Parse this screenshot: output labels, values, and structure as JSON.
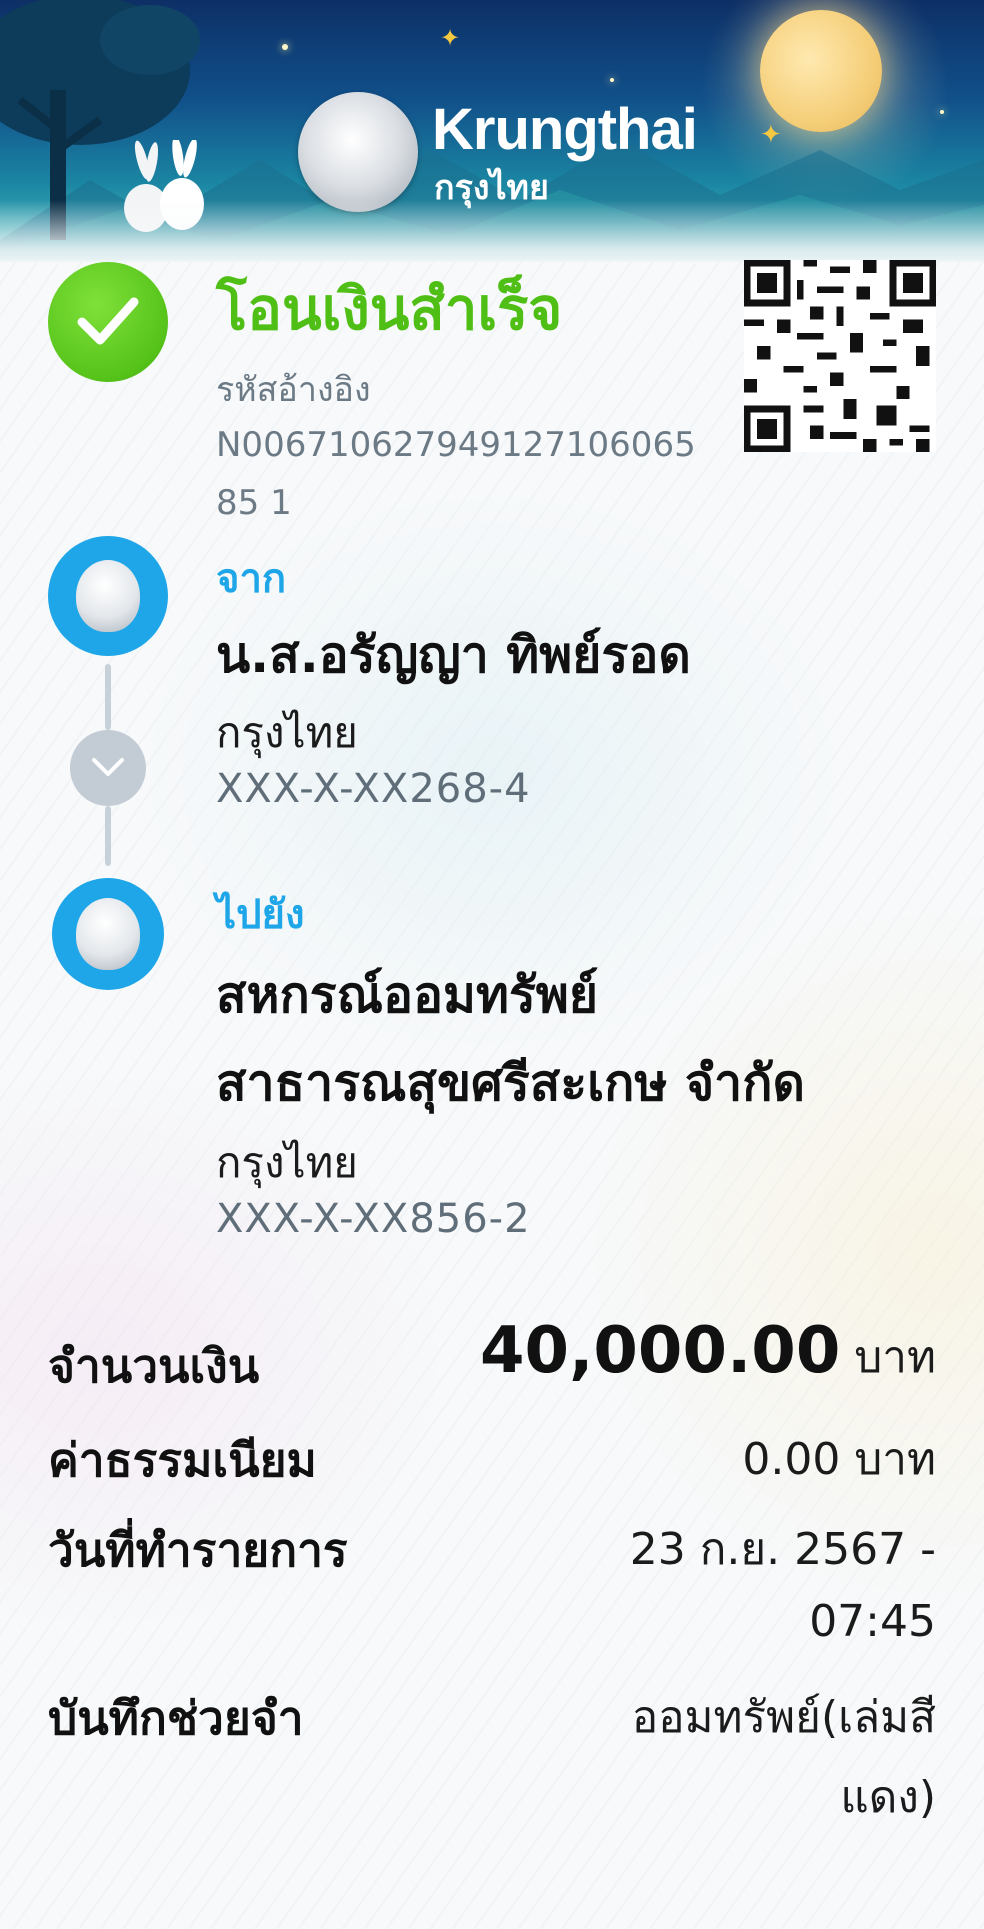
{
  "bank": {
    "name_en": "Krungthai",
    "name_th": "กรุงไทย"
  },
  "status": {
    "title": "โอนเงินสำเร็จ",
    "ref_label": "รหัสอ้างอิง",
    "ref_value": "N00671062794912710606585 1"
  },
  "from": {
    "label": "จาก",
    "name": "น.ส.อรัญญา ทิพย์รอด",
    "bank": "กรุงไทย",
    "account": "XXX-X-XX268-4"
  },
  "to": {
    "label": "ไปยัง",
    "name_line1": "สหกรณ์ออมทรัพย์",
    "name_line2": "สาธารณสุขศรีสะเกษ จำกัด",
    "bank": "กรุงไทย",
    "account": "XXX-X-XX856-2"
  },
  "details": {
    "amount_label": "จำนวนเงิน",
    "amount_value": "40,000.00",
    "amount_unit": "บาท",
    "fee_label": "ค่าธรรมเนียม",
    "fee_value": "0.00 บาท",
    "date_label": "วันที่ทำรายการ",
    "date_line1": "23 ก.ย. 2567 -",
    "date_line2": "07:45",
    "memo_label": "บันทึกช่วยจำ",
    "memo_line1": "ออมทรัพย์(เล่มสี",
    "memo_line2": "แดง)"
  },
  "icons": {
    "status": "check-icon",
    "qr": "qr-code-icon",
    "from": "krungthai-logo-icon",
    "arrow": "chevron-down-icon",
    "to": "krungthai-logo-icon"
  },
  "colors": {
    "success_green": "#4fbf16",
    "brand_blue": "#1ea6e8",
    "text_dark": "#111111",
    "text_gray": "#6c7a86"
  }
}
